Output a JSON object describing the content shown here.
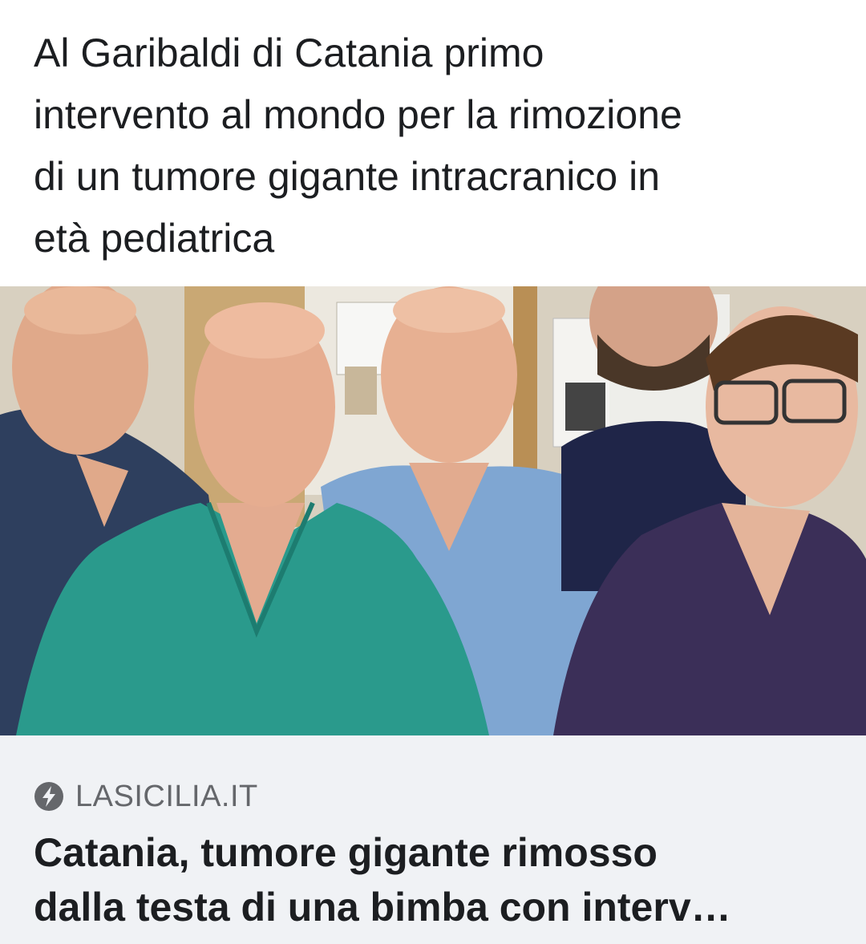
{
  "post": {
    "text": "Al Garibaldi di Catania primo\nintervento al mondo per la rimozione\ndi un tumore gigante intracranico in\netà pediatrica"
  },
  "link_preview": {
    "image_icon": "group-photo-of-five-doctors-in-scrubs",
    "source_icon": "lightning-bolt-icon",
    "source_domain": "LASICILIA.IT",
    "title": "Catania, tumore gigante rimosso\ndalla testa di una bimba con interv…"
  },
  "colors": {
    "text_primary": "#1c1e21",
    "text_secondary": "#65676b",
    "card_background": "#f0f2f5",
    "page_background": "#ffffff"
  }
}
